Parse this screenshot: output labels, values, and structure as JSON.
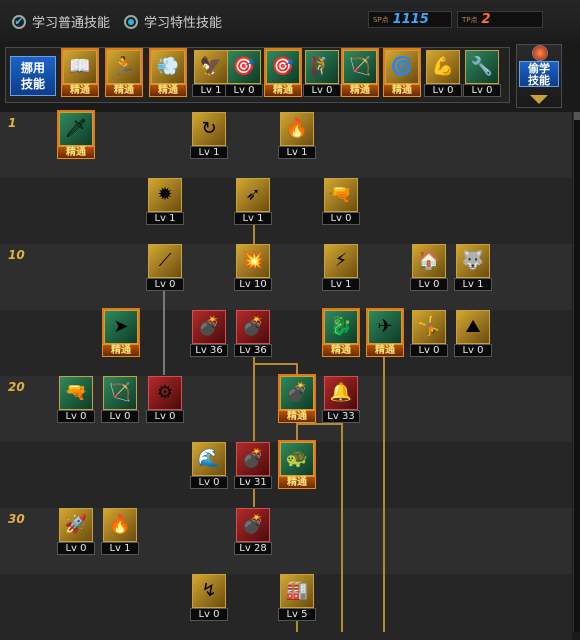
{
  "tabs": {
    "normal_label": "学习普通技能",
    "special_label": "学习特性技能"
  },
  "points": {
    "sp_tag": "SP点",
    "sp_value": "1115",
    "tp_tag": "TP点",
    "tp_value": "2"
  },
  "quickbar": {
    "label": "挪用技能",
    "slots": [
      {
        "cap": "精通",
        "style": "gold",
        "icon": "📖"
      },
      {
        "cap": "精通",
        "style": "gold",
        "icon": "🏃"
      },
      {
        "cap": "精通",
        "style": "gold",
        "icon": "💨"
      },
      {
        "cap": "Lv 1",
        "style": "gold",
        "icon": "🦅"
      },
      {
        "cap": "Lv 0",
        "style": "green",
        "icon": "🎯"
      },
      {
        "cap": "精通",
        "style": "green",
        "icon": "🎯"
      },
      {
        "cap": "Lv 0",
        "style": "green",
        "icon": "🧗"
      },
      {
        "cap": "精通",
        "style": "green",
        "icon": "🏹"
      },
      {
        "cap": "精通",
        "style": "gold",
        "icon": "🌀"
      },
      {
        "cap": "Lv 0",
        "style": "gold",
        "icon": "💪"
      },
      {
        "cap": "Lv 0",
        "style": "green",
        "icon": "🔧"
      }
    ]
  },
  "side_button": {
    "label": "偷学技能"
  },
  "level_marks": [
    "1",
    "10",
    "20",
    "30"
  ],
  "tree": [
    {
      "cap": "精通",
      "style": "green",
      "icon": "🗡"
    },
    {
      "cap": "Lv 1",
      "style": "gold",
      "icon": "↻"
    },
    {
      "cap": "Lv 1",
      "style": "gold",
      "icon": "🔥"
    },
    {
      "cap": "Lv 1",
      "style": "gold",
      "icon": "✹"
    },
    {
      "cap": "Lv 1",
      "style": "gold",
      "icon": "➶"
    },
    {
      "cap": "Lv 0",
      "style": "gold",
      "icon": "🔫"
    },
    {
      "cap": "Lv 0",
      "style": "gold",
      "icon": "⟋"
    },
    {
      "cap": "Lv 10",
      "style": "gold",
      "icon": "💥"
    },
    {
      "cap": "Lv 1",
      "style": "gold",
      "icon": "⚡"
    },
    {
      "cap": "Lv 0",
      "style": "gold",
      "icon": "🏠"
    },
    {
      "cap": "Lv 1",
      "style": "gold",
      "icon": "🐺"
    },
    {
      "cap": "精通",
      "style": "green",
      "icon": "➤"
    },
    {
      "cap": "Lv 36",
      "style": "red",
      "icon": "💣"
    },
    {
      "cap": "Lv 36",
      "style": "red",
      "icon": "💣"
    },
    {
      "cap": "精通",
      "style": "green",
      "icon": "🐉"
    },
    {
      "cap": "精通",
      "style": "green",
      "icon": "✈"
    },
    {
      "cap": "Lv 0",
      "style": "gold",
      "icon": "🤸"
    },
    {
      "cap": "Lv 0",
      "style": "gold",
      "icon": "⛰"
    },
    {
      "cap": "Lv 0",
      "style": "green",
      "icon": "🔫"
    },
    {
      "cap": "Lv 0",
      "style": "green",
      "icon": "🏹"
    },
    {
      "cap": "Lv 0",
      "style": "red",
      "icon": "⚙"
    },
    {
      "cap": "精通",
      "style": "green",
      "icon": "💣"
    },
    {
      "cap": "Lv 33",
      "style": "red",
      "icon": "🔔"
    },
    {
      "cap": "Lv 0",
      "style": "gold",
      "icon": "🌊"
    },
    {
      "cap": "Lv 31",
      "style": "red",
      "icon": "💣"
    },
    {
      "cap": "精通",
      "style": "green",
      "icon": "🐢"
    },
    {
      "cap": "Lv 0",
      "style": "gold",
      "icon": "🚀"
    },
    {
      "cap": "Lv 1",
      "style": "gold",
      "icon": "🔥"
    },
    {
      "cap": "Lv 28",
      "style": "red",
      "icon": "💣"
    },
    {
      "cap": "Lv 0",
      "style": "gold",
      "icon": "↯"
    },
    {
      "cap": "Lv 5",
      "style": "gold",
      "icon": "🏭"
    }
  ]
}
